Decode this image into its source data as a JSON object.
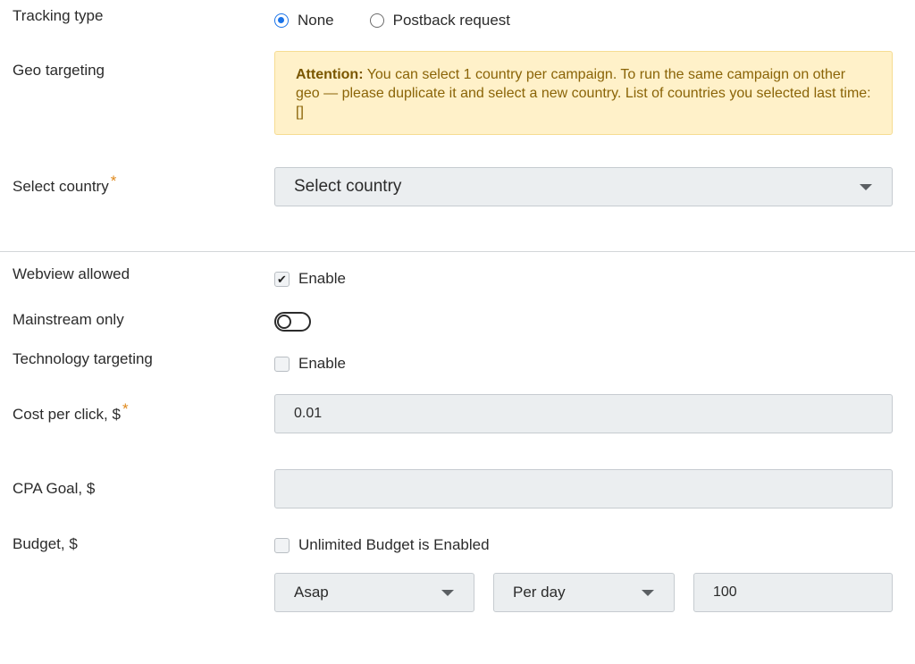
{
  "tracking": {
    "label": "Tracking type",
    "options": [
      {
        "label": "None",
        "selected": true
      },
      {
        "label": "Postback request",
        "selected": false
      }
    ]
  },
  "geo": {
    "label": "Geo targeting",
    "alert_strong": "Attention:",
    "alert_text": " You can select 1 country per campaign. To run the same campaign on other geo — please duplicate it and select a new country. List of countries you selected last time: []"
  },
  "country": {
    "label": "Select country",
    "required_mark": "*",
    "placeholder": "Select country"
  },
  "webview": {
    "label": "Webview allowed",
    "checkbox_label": "Enable",
    "checked": true,
    "check_glyph": "✔"
  },
  "mainstream": {
    "label": "Mainstream only",
    "toggle_on": false
  },
  "technology": {
    "label": "Technology targeting",
    "checkbox_label": "Enable",
    "checked": false
  },
  "cpc": {
    "label": "Cost per click, $",
    "required_mark": "*",
    "value": "0.01"
  },
  "cpa": {
    "label": "CPA Goal, $",
    "value": ""
  },
  "budget": {
    "label": "Budget, $",
    "unlimited_label": "Unlimited Budget is Enabled",
    "unlimited_checked": false,
    "pacing": "Asap",
    "period": "Per day",
    "amount": "100"
  },
  "colors": {
    "accent": "#1a73e8",
    "alert_bg": "#fff1c9",
    "alert_text": "#8a6407",
    "required": "#e0891c"
  }
}
